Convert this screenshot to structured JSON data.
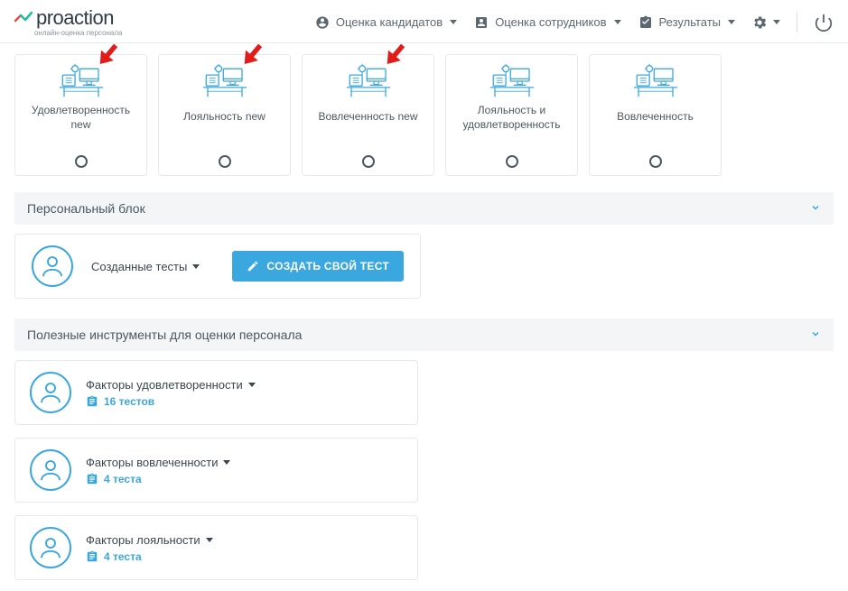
{
  "logo": {
    "text": "proaction",
    "tagline": "онлайн-оценка персонала"
  },
  "nav": {
    "candidate_assessment": "Оценка кандидатов",
    "employee_assessment": "Оценка сотрудников",
    "results": "Результаты"
  },
  "cards": [
    {
      "title": "Удовлетворенность new"
    },
    {
      "title": "Лояльность new"
    },
    {
      "title": "Вовлеченность new"
    },
    {
      "title": "Лояльность и удовлетворенность"
    },
    {
      "title": "Вовлеченность"
    }
  ],
  "sections": {
    "personal": "Персональный блок",
    "tools": "Полезные инструменты для оценки персонала"
  },
  "personal": {
    "created_tests": "Созданные тесты",
    "create_button": "СОЗДАТЬ СВОЙ ТЕСТ"
  },
  "tools": [
    {
      "title": "Факторы удовлетворенности",
      "count": "16 тестов"
    },
    {
      "title": "Факторы вовлеченности",
      "count": "4 теста"
    },
    {
      "title": "Факторы лояльности",
      "count": "4 теста"
    }
  ]
}
